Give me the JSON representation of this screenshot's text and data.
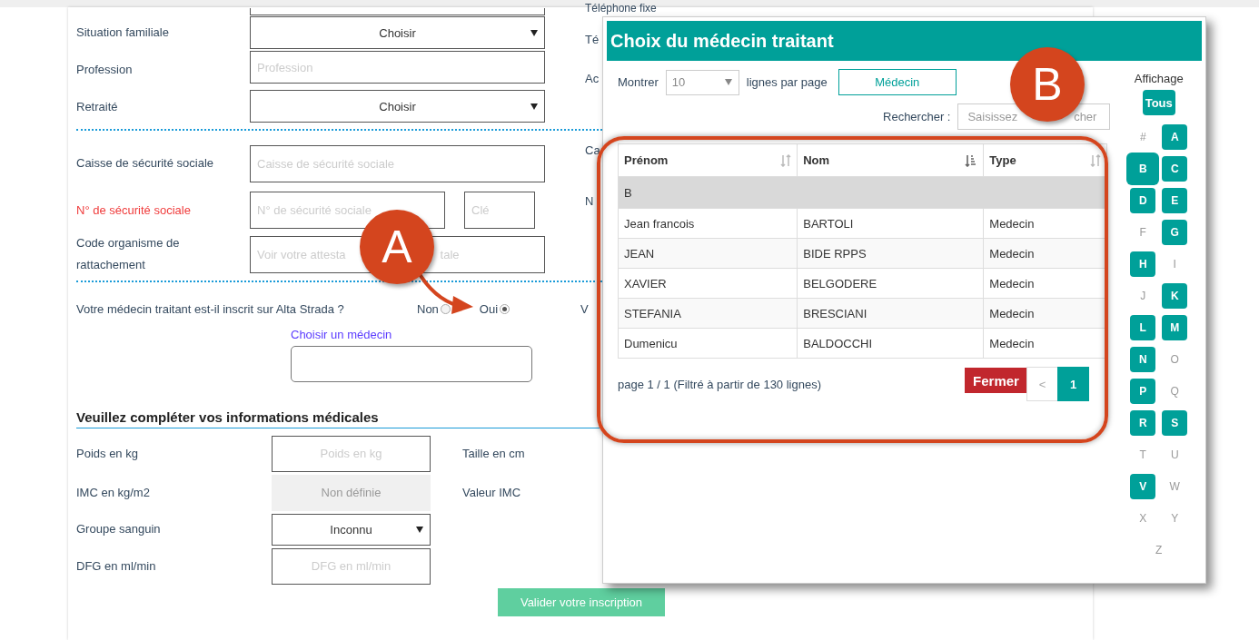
{
  "form": {
    "top_side_label": "Téléphone fixe",
    "identity_rows": [
      {
        "kind": "select",
        "label": "Situation familiale",
        "value": "Choisir",
        "side_label": "Té"
      },
      {
        "kind": "input",
        "label": "Profession",
        "placeholder": "Profession",
        "side_label": "Ac"
      },
      {
        "kind": "select",
        "label": "Retraité",
        "value": "Choisir"
      }
    ],
    "social_rows": [
      {
        "kind": "input",
        "label": "Caisse de sécurité sociale",
        "placeholder": "Caisse de sécurité sociale",
        "side_label": "Ca"
      },
      {
        "kind": "input_key",
        "label": "N° de sécurité sociale",
        "required": true,
        "placeholder": "N° de sécurité sociale",
        "key_placeholder": "Clé",
        "side_label": "N"
      },
      {
        "kind": "input",
        "label": "Code organisme de rattachement",
        "placeholder": "Voir votre attesta",
        "placeholder_tail": "tale"
      }
    ],
    "question": {
      "text": "Votre médecin traitant est-il inscrit sur Alta Strada ?",
      "side_label": "V",
      "options": [
        {
          "label": "Non",
          "selected": false
        },
        {
          "label": "Oui",
          "selected": true
        }
      ]
    },
    "doctor_picker": {
      "label": "Choisir un médecin"
    },
    "medical": {
      "title": "Veuillez compléter vos informations médicales",
      "rows": [
        {
          "kind": "input",
          "label": "Poids en kg",
          "placeholder": "Poids en kg",
          "side_label": "Taille en cm"
        },
        {
          "kind": "readonly",
          "label": "IMC en kg/m2",
          "placeholder": "Non définie",
          "side_label": "Valeur IMC"
        },
        {
          "kind": "select",
          "label": "Groupe sanguin",
          "value": "Inconnu"
        },
        {
          "kind": "input",
          "label": "DFG en ml/min",
          "placeholder": "DFG en ml/min"
        }
      ]
    },
    "submit": "Valider votre inscription"
  },
  "modal": {
    "title": "Choix du médecin traitant",
    "page_size_label": "Montrer",
    "page_size": "10",
    "page_size_suffix": "lignes par page",
    "type_filter": "Médecin",
    "search_label": "Rechercher :",
    "search_placeholder": "Saisissez",
    "search_placeholder_tail": "cher",
    "columns": [
      {
        "label": "Prénom",
        "sorted": false
      },
      {
        "label": "Nom",
        "sorted": true
      },
      {
        "label": "Type",
        "sorted": false
      }
    ],
    "group_label": "B",
    "rows": [
      [
        "Jean francois",
        "BARTOLI",
        "Medecin"
      ],
      [
        "JEAN",
        "BIDE RPPS",
        "Medecin"
      ],
      [
        "XAVIER",
        "BELGODERE",
        "Medecin"
      ],
      [
        "STEFANIA",
        "BRESCIANI",
        "Medecin"
      ],
      [
        "Dumenicu",
        "BALDOCCHI",
        "Medecin"
      ]
    ],
    "info": "page 1 / 1 (Filtré à partir de 130 lignes)",
    "close": "Fermer",
    "pagination": [
      {
        "label": "<",
        "selected": false
      },
      {
        "label": "1",
        "selected": true
      }
    ],
    "letters_title": "Affichage",
    "all_button": "Tous",
    "letters": [
      {
        "label": "#",
        "enabled": false,
        "selected": false
      },
      {
        "label": "A",
        "enabled": true,
        "selected": false
      },
      {
        "label": "B",
        "enabled": true,
        "selected": true
      },
      {
        "label": "C",
        "enabled": true,
        "selected": false
      },
      {
        "label": "D",
        "enabled": true,
        "selected": false
      },
      {
        "label": "E",
        "enabled": true,
        "selected": false
      },
      {
        "label": "F",
        "enabled": false,
        "selected": false
      },
      {
        "label": "G",
        "enabled": true,
        "selected": false
      },
      {
        "label": "H",
        "enabled": true,
        "selected": false
      },
      {
        "label": "I",
        "enabled": false,
        "selected": false
      },
      {
        "label": "J",
        "enabled": false,
        "selected": false
      },
      {
        "label": "K",
        "enabled": true,
        "selected": false
      },
      {
        "label": "L",
        "enabled": true,
        "selected": false
      },
      {
        "label": "M",
        "enabled": true,
        "selected": false
      },
      {
        "label": "N",
        "enabled": true,
        "selected": false
      },
      {
        "label": "O",
        "enabled": false,
        "selected": false
      },
      {
        "label": "P",
        "enabled": true,
        "selected": false
      },
      {
        "label": "Q",
        "enabled": false,
        "selected": false
      },
      {
        "label": "R",
        "enabled": true,
        "selected": false
      },
      {
        "label": "S",
        "enabled": true,
        "selected": false
      },
      {
        "label": "T",
        "enabled": false,
        "selected": false
      },
      {
        "label": "U",
        "enabled": false,
        "selected": false
      },
      {
        "label": "V",
        "enabled": true,
        "selected": false
      },
      {
        "label": "W",
        "enabled": false,
        "selected": false
      },
      {
        "label": "X",
        "enabled": false,
        "selected": false
      },
      {
        "label": "Y",
        "enabled": false,
        "selected": false
      },
      {
        "label": "Z",
        "enabled": false,
        "selected": false
      }
    ]
  },
  "annotations": [
    {
      "label": "A"
    },
    {
      "label": "B"
    }
  ]
}
